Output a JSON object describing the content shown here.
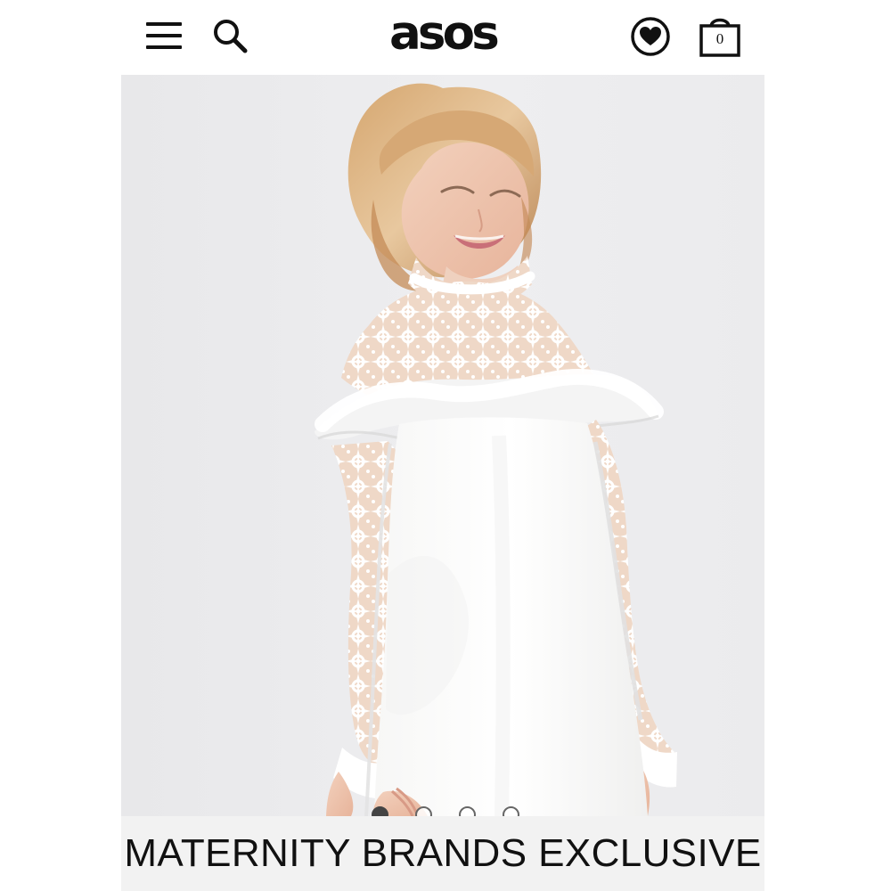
{
  "header": {
    "logo_text": "asos",
    "icons": {
      "menu": "hamburger-menu-icon",
      "search": "search-icon",
      "saved": "heart-saved-icon",
      "bag": "shopping-bag-icon"
    },
    "bag_count": "0"
  },
  "product_gallery": {
    "image_description": "",
    "current_slide": 1,
    "total_slides": 4
  },
  "banner": {
    "text": "MATERNITY BRANDS EXCLUSIVE"
  },
  "colors": {
    "text": "#111111",
    "hero_background": "#ececef",
    "dress": "#ffffff",
    "active_dot": "#444444"
  }
}
